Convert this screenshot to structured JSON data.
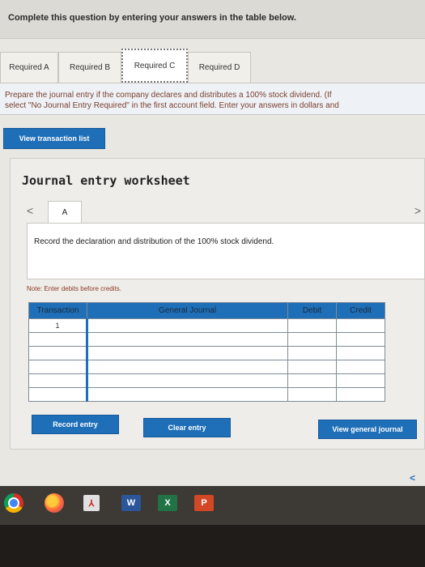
{
  "header": {
    "title": "Complete this question by entering your answers in the table below."
  },
  "tabs": [
    {
      "label": "Required A",
      "active": false
    },
    {
      "label": "Required B",
      "active": false
    },
    {
      "label": "Required C",
      "active": true
    },
    {
      "label": "Required D",
      "active": false
    }
  ],
  "instructions": {
    "line1": "Prepare the journal entry if the company declares and distributes a 100% stock dividend. (If",
    "line2": "select \"No Journal Entry Required\" in the first account field. Enter your answers in dollars and"
  },
  "buttons": {
    "view_transaction_list": "View transaction list",
    "record_entry": "Record entry",
    "clear_entry": "Clear entry",
    "view_general_journal": "View general journal"
  },
  "worksheet": {
    "title": "Journal entry worksheet",
    "tab_label": "A",
    "prev_glyph": "<",
    "next_glyph": ">",
    "record_text": "Record the declaration and distribution of the 100% stock dividend.",
    "note": "Note: Enter debits before credits."
  },
  "table": {
    "headers": {
      "transaction": "Transaction",
      "general_journal": "General Journal",
      "debit": "Debit",
      "credit": "Credit"
    },
    "rows": [
      {
        "transaction": "1",
        "account": "",
        "debit": "",
        "credit": ""
      },
      {
        "transaction": "",
        "account": "",
        "debit": "",
        "credit": ""
      },
      {
        "transaction": "",
        "account": "",
        "debit": "",
        "credit": ""
      },
      {
        "transaction": "",
        "account": "",
        "debit": "",
        "credit": ""
      },
      {
        "transaction": "",
        "account": "",
        "debit": "",
        "credit": ""
      },
      {
        "transaction": "",
        "account": "",
        "debit": "",
        "credit": ""
      }
    ]
  },
  "taskbar": {
    "icons": [
      "chrome-icon",
      "firefox-icon",
      "pdf-icon",
      "word-icon",
      "excel-icon",
      "powerpoint-icon"
    ],
    "word_glyph": "W",
    "excel_glyph": "X",
    "ppt_glyph": "P",
    "pdf_glyph": "⅄"
  },
  "colors": {
    "accent": "#1e6fb8",
    "instruction_text": "#7a4030"
  }
}
